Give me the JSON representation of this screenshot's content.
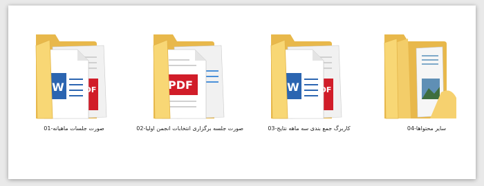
{
  "folders": [
    {
      "name": "صورت جلسات ماهیانه-01",
      "content": "word-pdf",
      "icon": "folder-documents-icon"
    },
    {
      "name": "صورت جلسه برگزاری انتخابات انجمن اولیا-02",
      "content": "pdf",
      "icon": "folder-documents-icon"
    },
    {
      "name": "کاربرگ جمع بندی سه ماهه نتایج-03",
      "content": "word-pdf",
      "icon": "folder-documents-icon"
    },
    {
      "name": "سایر محتواها-04",
      "content": "image",
      "icon": "folder-images-icon"
    }
  ],
  "colors": {
    "folder_light": "#f8d775",
    "folder_dark": "#e8b84b",
    "word_blue": "#2b65b1",
    "pdf_red": "#d11d29"
  },
  "badges": {
    "word": "W",
    "pdf": "PDF"
  }
}
